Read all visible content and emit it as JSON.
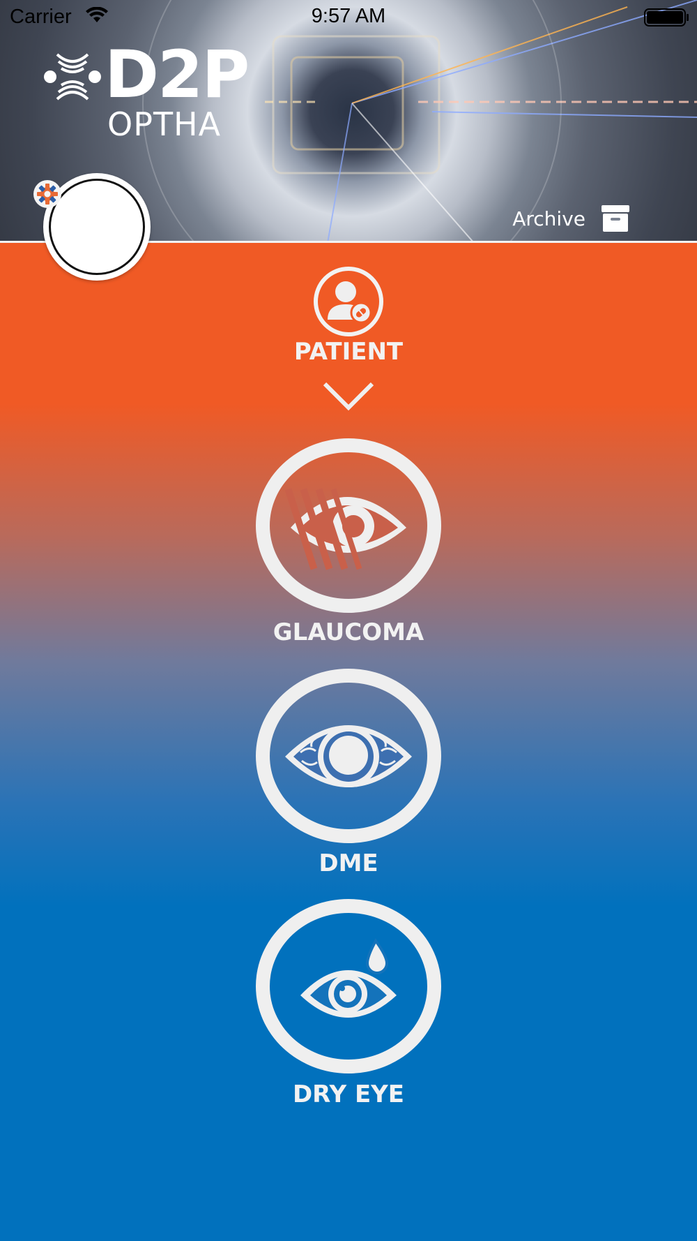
{
  "status_bar": {
    "carrier": "Carrier",
    "time": "9:57 AM"
  },
  "logo": {
    "title": "D2P",
    "subtitle": "OPTHA"
  },
  "header": {
    "archive_label": "Archive"
  },
  "patient": {
    "label": "PATIENT"
  },
  "conditions": [
    {
      "label": "GLAUCOMA",
      "icon": "glaucoma-eye-icon"
    },
    {
      "label": "DME",
      "icon": "dme-eye-icon"
    },
    {
      "label": "DRY EYE",
      "icon": "dry-eye-icon"
    }
  ],
  "colors": {
    "orange": "#f05a25",
    "blue": "#0171bd",
    "icon_white": "#efefef"
  }
}
